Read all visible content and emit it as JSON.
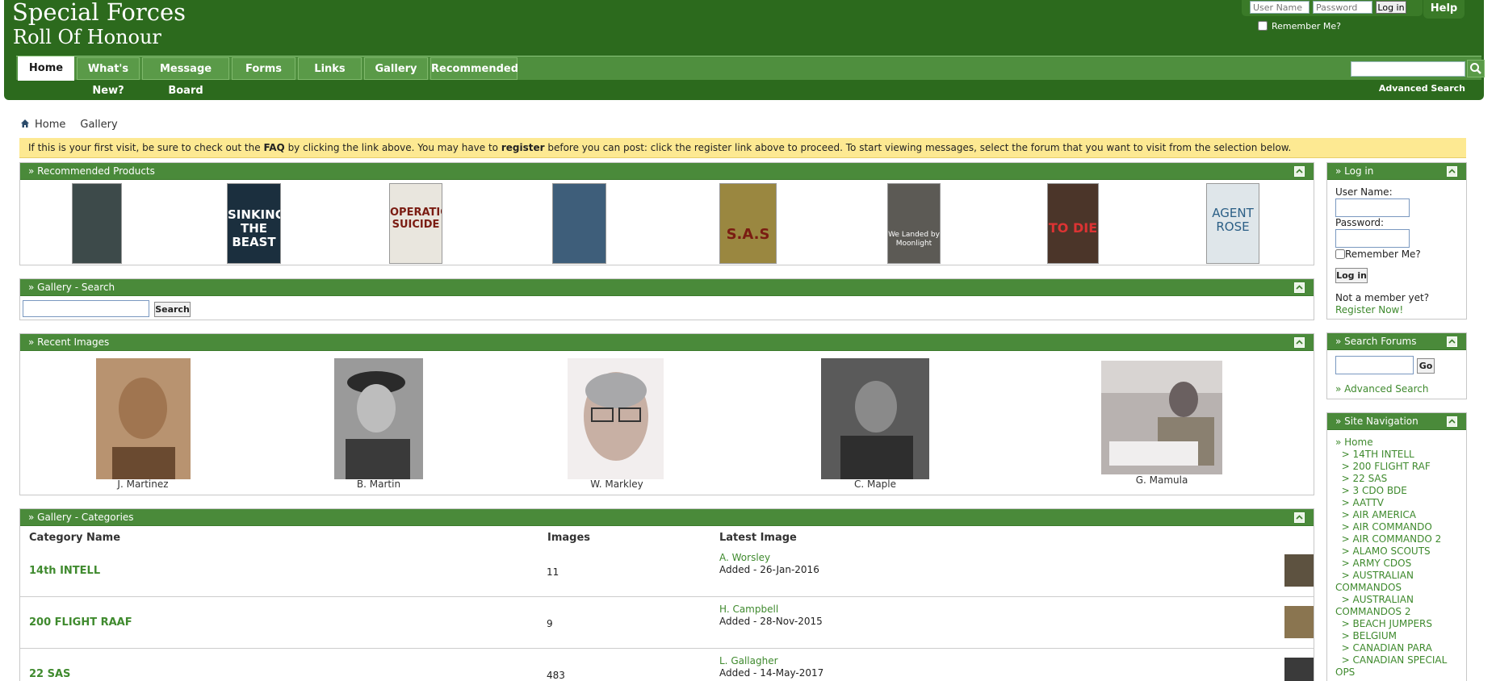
{
  "site": {
    "title_line1": "Special Forces",
    "title_line2": "Roll Of Honour"
  },
  "top_login": {
    "username_placeholder": "User Name",
    "password_placeholder": "Password",
    "login_button": "Log in",
    "remember_label": "Remember Me?",
    "help_label": "Help"
  },
  "nav": {
    "tabs": [
      {
        "label": "Home"
      },
      {
        "label": "What's New?"
      },
      {
        "label": "Message Board"
      },
      {
        "label": "Forms"
      },
      {
        "label": "Links"
      },
      {
        "label": "Gallery"
      },
      {
        "label": "Recommended"
      }
    ],
    "advanced_search": "Advanced Search"
  },
  "breadcrumb": {
    "home": "Home",
    "current": "Gallery"
  },
  "notice": {
    "part1": "If this is your first visit, be sure to check out the ",
    "faq": "FAQ",
    "part2": " by clicking the link above. You may have to ",
    "register": "register",
    "part3": " before you can post: click the register link above to proceed. To start viewing messages, select the forum that you want to visit from the selection below."
  },
  "recommended_products": {
    "title": "» Recommended Products",
    "items": [
      {
        "name": "book-1",
        "bg": "#3d4a4a",
        "text": ""
      },
      {
        "name": "book-2",
        "bg": "#1b2f3e",
        "text": "SINKING THE BEAST"
      },
      {
        "name": "book-3",
        "bg": "#e9e6de",
        "text": "OPERATION SUICIDE"
      },
      {
        "name": "book-4",
        "bg": "#3e5e7a",
        "text": ""
      },
      {
        "name": "book-5",
        "bg": "#9a8740",
        "text": "S.A.S"
      },
      {
        "name": "book-6",
        "bg": "#5c5a55",
        "text": "We Landed by Moonlight"
      },
      {
        "name": "book-7",
        "bg": "#4b3529",
        "text": "TO DIE"
      },
      {
        "name": "book-8",
        "bg": "#dfe6ea",
        "text": "AGENT ROSE"
      }
    ]
  },
  "gallery_search": {
    "title": "» Gallery - Search",
    "button": "Search"
  },
  "recent_images": {
    "title": "» Recent Images",
    "items": [
      {
        "name": "J. Martinez",
        "bg": "#8a6a48"
      },
      {
        "name": "B. Martin",
        "bg": "#4d4d4d"
      },
      {
        "name": "W. Markley",
        "bg": "#c8b6aa"
      },
      {
        "name": "C. Maple",
        "bg": "#3c3c3c"
      },
      {
        "name": "G. Mamula",
        "bg": "#8d8684"
      }
    ]
  },
  "categories": {
    "title": "» Gallery - Categories",
    "headers": {
      "name": "Category Name",
      "images": "Images",
      "latest": "Latest Image"
    },
    "rows": [
      {
        "name": "14th INTELL",
        "count": "11",
        "latest_name": "A. Worsley",
        "latest_date": "Added - 26-Jan-2016",
        "thumb": "#5d5240"
      },
      {
        "name": "200 FLIGHT RAAF",
        "count": "9",
        "latest_name": "H. Campbell",
        "latest_date": "Added - 28-Nov-2015",
        "thumb": "#8a7550"
      },
      {
        "name": "22 SAS",
        "count": "483",
        "latest_name": "L. Gallagher",
        "latest_date": "Added - 14-May-2017",
        "thumb": "#3a3a3a"
      }
    ]
  },
  "side_login": {
    "title": "» Log in",
    "username_label": "User Name:",
    "password_label": "Password:",
    "remember_label": "Remember Me?",
    "button": "Log in",
    "not_member": "Not a member yet?",
    "register": "Register Now!"
  },
  "side_search": {
    "title": "» Search Forums",
    "button": "Go",
    "advanced": "» Advanced Search"
  },
  "side_nav": {
    "title": "» Site Navigation",
    "items": [
      "» Home",
      "  > 14TH INTELL",
      "  > 200 FLIGHT RAF",
      "  > 22 SAS",
      "  > 3 CDO BDE",
      "  > AATTV",
      "  > AIR AMERICA",
      "  > AIR COMMANDO",
      "  > AIR COMMANDO 2",
      "  > ALAMO SCOUTS",
      "  > ARMY CDOS",
      "  > AUSTRALIAN COMMANDOS",
      "  > AUSTRALIAN COMMANDOS 2",
      "  > BEACH JUMPERS",
      "  > BELGIUM",
      "  > CANADIAN PARA",
      "  > CANADIAN SPECIAL OPS"
    ]
  }
}
